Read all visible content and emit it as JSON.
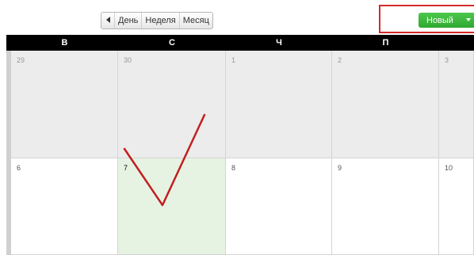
{
  "toolbar": {
    "prev_symbol": "",
    "views": [
      "День",
      "Неделя",
      "Месяц"
    ],
    "new_button_label": "Новый"
  },
  "weekday_headers": [
    "В",
    "С",
    "Ч",
    "П"
  ],
  "weeks": [
    [
      "29",
      "30",
      "1",
      "2",
      "3"
    ],
    [
      "6",
      "7",
      "8",
      "9",
      "10"
    ]
  ],
  "today_date": "7",
  "colors": {
    "header_bg": "#000000",
    "new_button": "#33aa33",
    "highlight_box": "#d32a2a",
    "checkmark": "#c21f1f",
    "today_bg": "#e6f3e3",
    "other_month_bg": "#ececec"
  },
  "icons": {
    "prev": "arrow-left-icon",
    "dropdown": "caret-down-icon",
    "annotation": "checkmark-annotation"
  }
}
